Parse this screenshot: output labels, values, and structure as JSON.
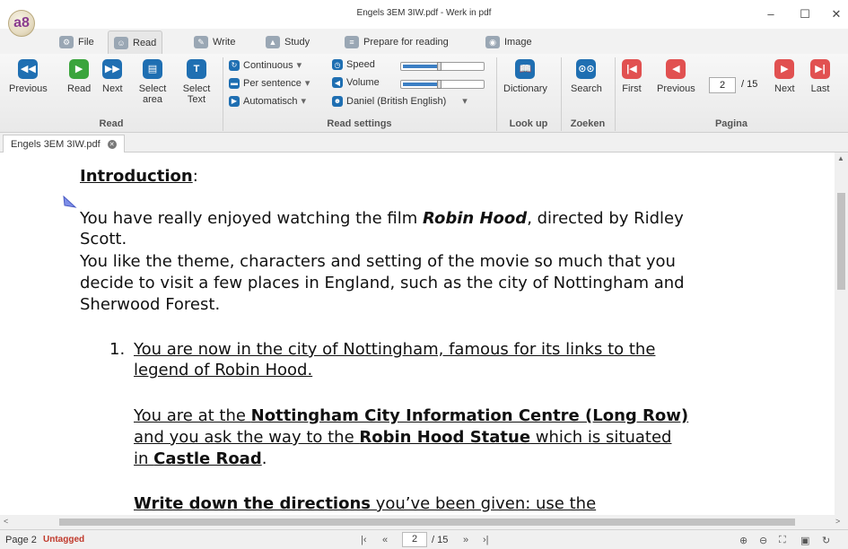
{
  "window": {
    "title": "Engels 3EM 3IW.pdf - Werk in pdf",
    "app_logo": "a8",
    "controls": {
      "minimize": "–",
      "maximize": "☐",
      "close": "✕"
    }
  },
  "tabs": [
    {
      "label": "File",
      "icon": "gear-icon"
    },
    {
      "label": "Read",
      "icon": "reader-icon",
      "active": true
    },
    {
      "label": "Write",
      "icon": "pen-icon"
    },
    {
      "label": "Study",
      "icon": "graduation-cap-icon"
    },
    {
      "label": "Prepare for reading",
      "icon": "document-icon"
    },
    {
      "label": "Image",
      "icon": "image-icon"
    }
  ],
  "ribbon": {
    "read": {
      "group_label": "Read",
      "previous": "Previous",
      "read": "Read",
      "next": "Next",
      "select_area": "Select area",
      "select_text": "Select Text"
    },
    "settings": {
      "group_label": "Read settings",
      "continuous": "Continuous",
      "per_sentence": "Per sentence",
      "automatisch": "Automatisch",
      "speed": "Speed",
      "volume": "Volume",
      "voice": "Daniel (British English)",
      "speed_level": 0.45,
      "volume_level": 0.45
    },
    "lookup": {
      "group_label": "Look up",
      "dictionary": "Dictionary"
    },
    "search": {
      "group_label": "Zoeken",
      "search": "Search"
    },
    "pagina": {
      "group_label": "Pagina",
      "first": "First",
      "previous": "Previous",
      "page": "2",
      "total": "/ 15",
      "next": "Next",
      "last": "Last"
    }
  },
  "doc_tab": {
    "label": "Engels 3EM 3IW.pdf"
  },
  "document": {
    "intro_heading": "Introduction",
    "intro_colon": ":",
    "p1_a": "You have really enjoyed watching the film ",
    "p1_film": "Robin Hood",
    "p1_b": ", directed by Ridley",
    "p1_c": "Scott.",
    "p2_l1": "You like the theme, characters and setting of the movie so much that you",
    "p2_l2": "decide to visit a few places in England, such as the city of Nottingham and",
    "p2_l3": "Sherwood Forest.",
    "item_number": "1.",
    "item_l1": "You are now in the city of Nottingham, famous for its links to the",
    "item_l2": "legend of Robin Hood.",
    "p3_a": "You are at the ",
    "p3_b": "Nottingham City Information Centre (Long Row)",
    "p3_c": "and you ask the way to the ",
    "p3_d": "Robin Hood Statue",
    "p3_e": "  which is situated",
    "p3_f": "in ",
    "p3_g": "Castle Road",
    "p3_h": ".",
    "p4_a": "Write down the directions",
    "p4_b": " you’ve been given: use the"
  },
  "status": {
    "page": "Page 2",
    "tag": "Untagged",
    "page_value": "2",
    "page_total": "/ 15"
  },
  "colors": {
    "accent_blue": "#1f6fb2",
    "green": "#3aa43c",
    "red": "#e15151",
    "untagged": "#c0392b"
  }
}
